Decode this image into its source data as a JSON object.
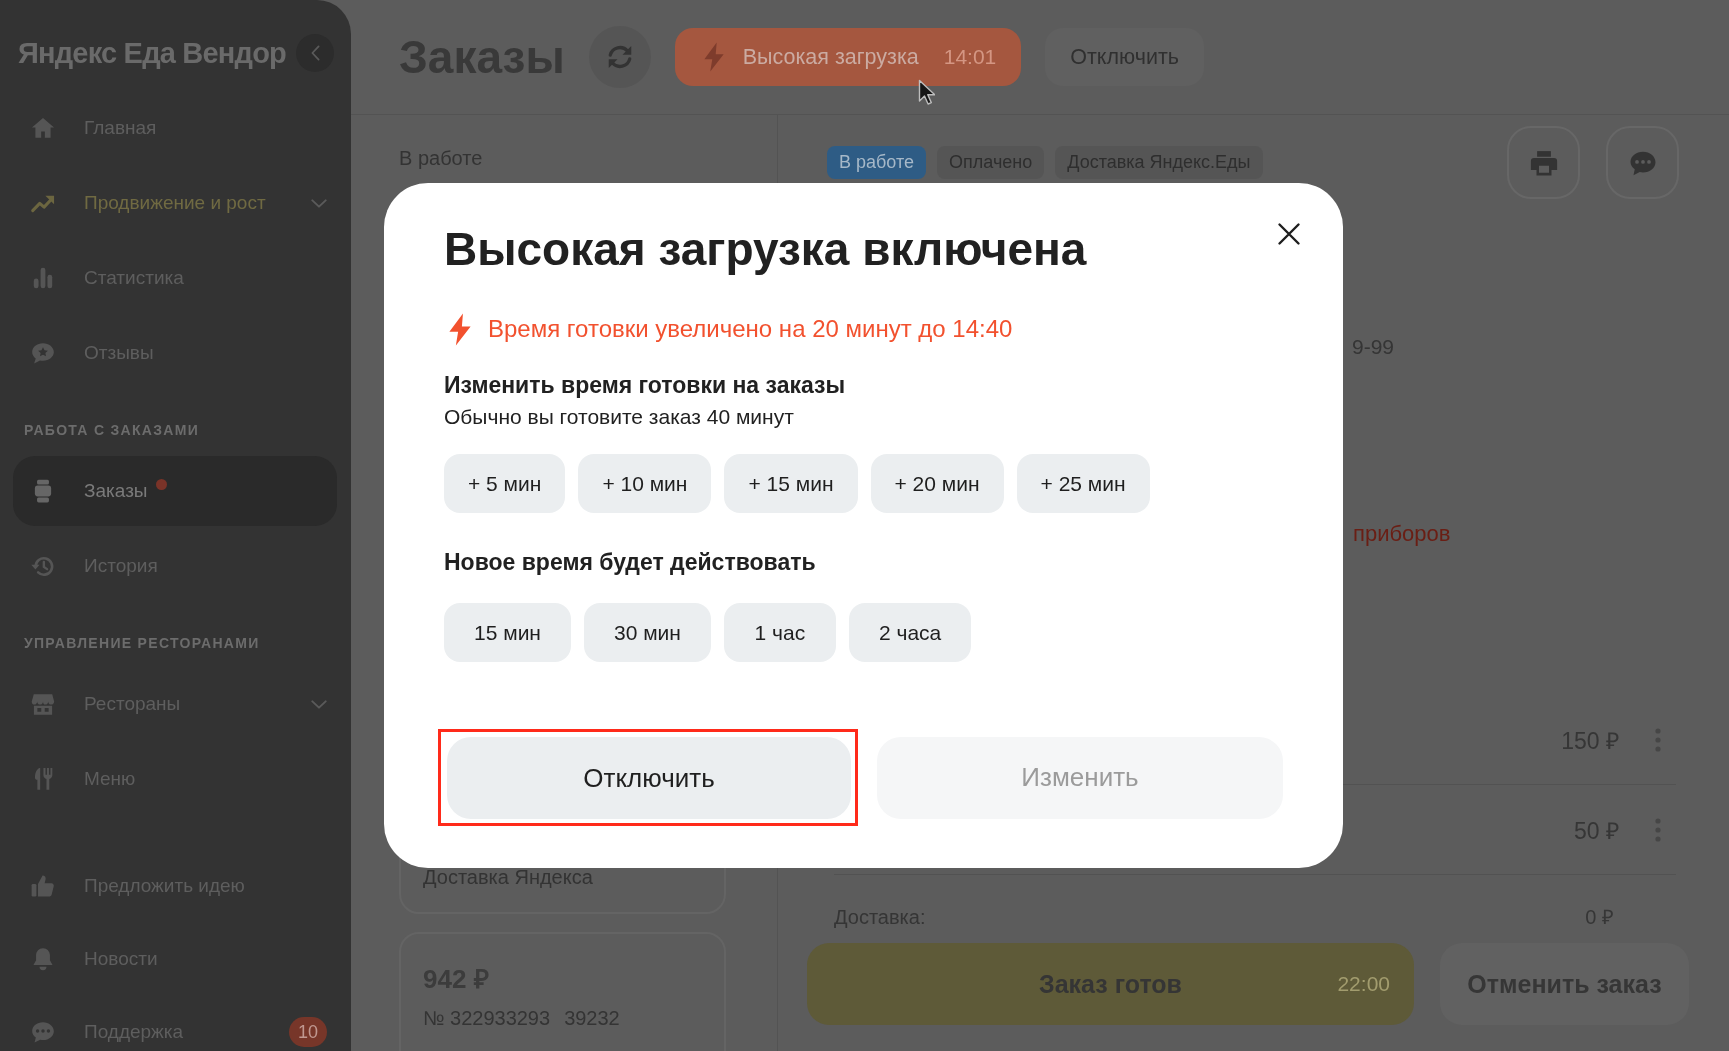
{
  "sidebar": {
    "logo": "Яндекс Еда Вендор",
    "groups": [
      {
        "items": [
          {
            "label": "Главная",
            "kind": "link",
            "selected": false,
            "highlighted": false,
            "alert": false
          },
          {
            "label": "Продвижение и рост",
            "kind": "group",
            "selected": false,
            "highlighted": true,
            "alert": false
          },
          {
            "label": "Статистика",
            "kind": "link",
            "selected": false,
            "highlighted": false,
            "alert": false
          },
          {
            "label": "Отзывы",
            "kind": "link",
            "selected": false,
            "highlighted": false,
            "alert": false
          }
        ]
      },
      {
        "heading": "РАБОТА С ЗАКАЗАМИ",
        "items": [
          {
            "label": "Заказы",
            "kind": "link",
            "selected": true,
            "highlighted": false,
            "alert": true
          },
          {
            "label": "История",
            "kind": "link",
            "selected": false,
            "highlighted": false,
            "alert": false
          }
        ]
      },
      {
        "heading": "УПРАВЛЕНИЕ РЕСТОРАНАМИ",
        "items": [
          {
            "label": "Рестораны",
            "kind": "group",
            "selected": false,
            "highlighted": false,
            "alert": false
          },
          {
            "label": "Меню",
            "kind": "link",
            "selected": false,
            "highlighted": false,
            "alert": false
          }
        ]
      },
      {
        "items": [
          {
            "label": "Предложить идею",
            "kind": "link",
            "selected": false,
            "highlighted": false,
            "alert": false
          },
          {
            "label": "Новости",
            "kind": "link",
            "selected": false,
            "highlighted": false,
            "alert": false
          },
          {
            "label": "Поддержка",
            "kind": "link",
            "selected": false,
            "highlighted": false,
            "alert": false,
            "badge": "10"
          }
        ]
      }
    ]
  },
  "header": {
    "title": "Заказы",
    "load_button": {
      "label": "Высокая загрузка",
      "time": "14:01"
    },
    "disable_button": "Отключить"
  },
  "orders": {
    "title": "В работе",
    "cards": [
      {
        "kind": "partial",
        "delivery": "Доставка Яндекса"
      },
      {
        "kind": "full",
        "price": "942 ₽",
        "number": "№ 322933293",
        "code": "39232"
      }
    ]
  },
  "details": {
    "tags": [
      {
        "label": "В работе",
        "kind": "status"
      },
      {
        "label": "Оплачено",
        "kind": "info"
      },
      {
        "label": "Доставка Яндекс.Еды",
        "kind": "info"
      }
    ],
    "fragments": [
      {
        "text": "9-99",
        "kind": "plain"
      },
      {
        "text": "приборов",
        "kind": "warning"
      }
    ],
    "items": [
      {
        "price": "150 ₽"
      },
      {
        "price": "50 ₽"
      }
    ],
    "delivery": {
      "label": "Доставка:",
      "value": "0 ₽"
    },
    "ready_button": {
      "label": "Заказ готов",
      "time": "22:00"
    },
    "cancel_button": "Отменить заказ"
  },
  "modal": {
    "title": "Высокая загрузка включена",
    "notice": "Время готовки увеличено на 20 минут до 14:40",
    "extra_time": {
      "heading": "Изменить время готовки на заказы",
      "hint": "Обычно вы готовите заказ 40 минут",
      "options": [
        {
          "label": "+ 5 мин",
          "selected": false
        },
        {
          "label": "+ 10 мин",
          "selected": false
        },
        {
          "label": "+ 15 мин",
          "selected": false
        },
        {
          "label": "+ 20 мин",
          "selected": false
        },
        {
          "label": "+ 25 мин",
          "selected": false
        }
      ]
    },
    "duration": {
      "heading": "Новое время будет действовать",
      "options": [
        {
          "label": "15 мин",
          "selected": false
        },
        {
          "label": "30 мин",
          "selected": false
        },
        {
          "label": "1 час",
          "selected": false
        },
        {
          "label": "2 часа",
          "selected": false
        }
      ]
    },
    "buttons": [
      {
        "label": "Отключить",
        "disabled": false,
        "highlighted": true
      },
      {
        "label": "Изменить",
        "disabled": true,
        "highlighted": false
      }
    ]
  }
}
